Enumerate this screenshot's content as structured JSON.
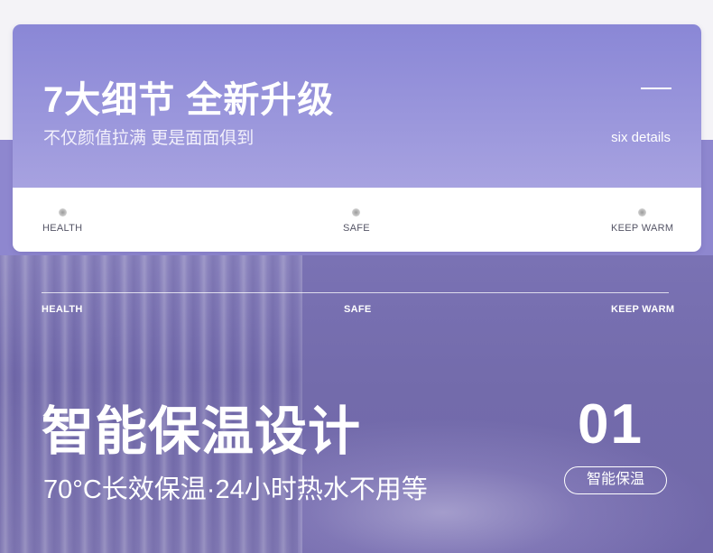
{
  "header": {
    "title": "7大细节  全新升级",
    "subtitle": "不仅颜值拉满 更是面面俱到",
    "en_label": "six details"
  },
  "features": [
    {
      "label": "HEALTH"
    },
    {
      "label": "SAFE"
    },
    {
      "label": "KEEP WARM"
    }
  ],
  "section": {
    "features": [
      {
        "label": "HEALTH"
      },
      {
        "label": "SAFE"
      },
      {
        "label": "KEEP WARM"
      }
    ],
    "title": "智能保温设计",
    "description": "70°C长效保温·24小时热水不用等",
    "number": "01",
    "tag": "智能保温"
  },
  "colors": {
    "header_gradient_start": "#8a87d6",
    "header_gradient_end": "#a7a2e0",
    "band": "#8e87cf",
    "photo_base": "#7a72b4",
    "text_light": "#ffffff"
  }
}
